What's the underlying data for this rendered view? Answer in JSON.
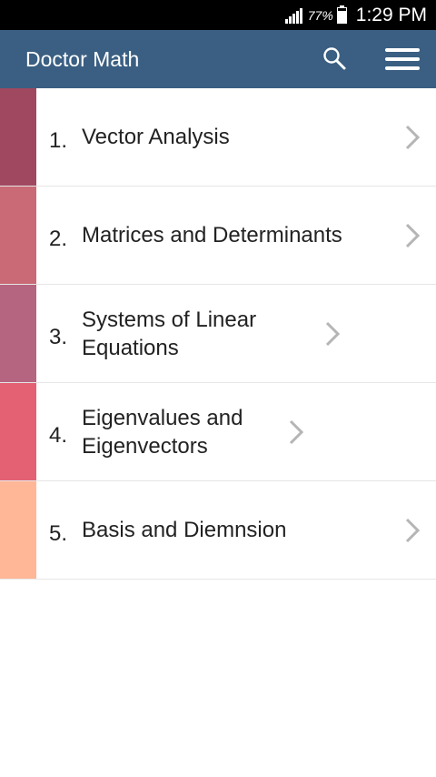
{
  "status_bar": {
    "battery_percent": "77%",
    "battery_level": 0.77,
    "time": "1:29 PM"
  },
  "app_bar": {
    "title": "Doctor Math",
    "search_icon": "search-icon",
    "menu_icon": "hamburger-menu-icon"
  },
  "chapters": [
    {
      "number": "1.",
      "title": "Vector Analysis",
      "color": "#a0485f"
    },
    {
      "number": "2.",
      "title": "Matrices and Determinants",
      "color": "#ca6a76"
    },
    {
      "number": "3.",
      "title": "Systems of Linear Equations",
      "color": "#b66580"
    },
    {
      "number": "4.",
      "title": "Eigenvalues and Eigenvectors",
      "color": "#e36173"
    },
    {
      "number": "5.",
      "title": "Basis and Diemnsion",
      "color": "#ffb797"
    }
  ]
}
